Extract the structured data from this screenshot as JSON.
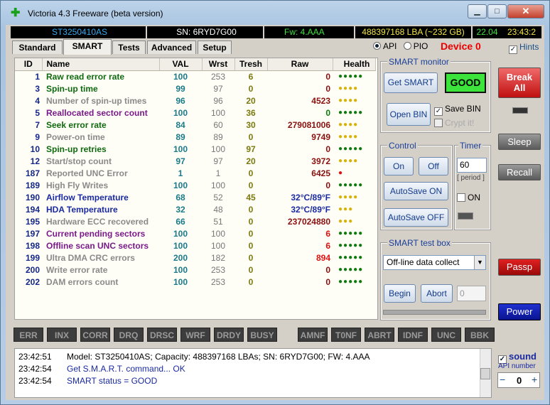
{
  "window": {
    "title": "Victoria 4.3 Freeware (beta version)",
    "min": "▁",
    "max": "□",
    "close": "✕",
    "app_icon": "green-plus-icon"
  },
  "info_bar": {
    "model": "ST3250410AS",
    "serial": "SN: 6RYD7G00",
    "firmware": "Fw: 4.AAA",
    "lba": "488397168 LBA (~232 GB)",
    "date": "22.04",
    "time": "23:43:2"
  },
  "tabs": [
    {
      "label": "Standard"
    },
    {
      "label": "SMART"
    },
    {
      "label": "Tests"
    },
    {
      "label": "Advanced"
    },
    {
      "label": "Setup"
    }
  ],
  "mode": {
    "api": "API",
    "pio": "PIO",
    "device": "Device 0",
    "hints": "Hints",
    "hints_check": "✓"
  },
  "table": {
    "headers": {
      "id": "ID",
      "name": "Name",
      "val": "VAL",
      "wrst": "Wrst",
      "tresh": "Tresh",
      "raw": "Raw",
      "health": "Health"
    },
    "rows": [
      {
        "id": "1",
        "name": "Raw read error rate",
        "val": "100",
        "wrst": "253",
        "tresh": "6",
        "raw": "0",
        "health": "●●●●●",
        "name_color": "#0f6a0f",
        "raw_color": "#8a1010",
        "health_color": "#0f7a0f"
      },
      {
        "id": "3",
        "name": "Spin-up time",
        "val": "99",
        "wrst": "97",
        "tresh": "0",
        "raw": "0",
        "health": "●●●●",
        "name_color": "#0f6a0f",
        "raw_color": "#8a1010",
        "health_color": "#d7b20a"
      },
      {
        "id": "4",
        "name": "Number of spin-up times",
        "val": "96",
        "wrst": "96",
        "tresh": "20",
        "raw": "4523",
        "health": "●●●●",
        "name_color": "#8a8a8a",
        "raw_color": "#8a1010",
        "health_color": "#d7b20a"
      },
      {
        "id": "5",
        "name": "Reallocated sector count",
        "val": "100",
        "wrst": "100",
        "tresh": "36",
        "raw": "0",
        "health": "●●●●●",
        "name_color": "#7a1a8a",
        "raw_color": "#0f7a0f",
        "health_color": "#0f7a0f"
      },
      {
        "id": "7",
        "name": "Seek error rate",
        "val": "84",
        "wrst": "60",
        "tresh": "30",
        "raw": "279081006",
        "health": "●●●●",
        "name_color": "#0f6a0f",
        "raw_color": "#8a1010",
        "health_color": "#d7b20a"
      },
      {
        "id": "9",
        "name": "Power-on time",
        "val": "89",
        "wrst": "89",
        "tresh": "0",
        "raw": "9749",
        "health": "●●●●",
        "name_color": "#8a8a8a",
        "raw_color": "#8a1010",
        "health_color": "#d7b20a"
      },
      {
        "id": "10",
        "name": "Spin-up retries",
        "val": "100",
        "wrst": "100",
        "tresh": "97",
        "raw": "0",
        "health": "●●●●●",
        "name_color": "#0f6a0f",
        "raw_color": "#8a1010",
        "health_color": "#0f7a0f"
      },
      {
        "id": "12",
        "name": "Start/stop count",
        "val": "97",
        "wrst": "97",
        "tresh": "20",
        "raw": "3972",
        "health": "●●●●",
        "name_color": "#8a8a8a",
        "raw_color": "#8a1010",
        "health_color": "#d7b20a"
      },
      {
        "id": "187",
        "name": "Reported UNC Error",
        "val": "1",
        "wrst": "1",
        "tresh": "0",
        "raw": "6425",
        "health": "●",
        "name_color": "#8a8a8a",
        "raw_color": "#8a1010",
        "health_color": "#e01010"
      },
      {
        "id": "189",
        "name": "High Fly Writes",
        "val": "100",
        "wrst": "100",
        "tresh": "0",
        "raw": "0",
        "health": "●●●●●",
        "name_color": "#8a8a8a",
        "raw_color": "#8a1010",
        "health_color": "#0f7a0f"
      },
      {
        "id": "190",
        "name": "Airflow Temperature",
        "val": "68",
        "wrst": "52",
        "tresh": "45",
        "raw": "32°C/89°F",
        "health": "●●●●",
        "name_color": "#1a2aa0",
        "raw_color": "#1a2aa0",
        "health_color": "#d7b20a"
      },
      {
        "id": "194",
        "name": "HDA Temperature",
        "val": "32",
        "wrst": "48",
        "tresh": "0",
        "raw": "32°C/89°F",
        "health": "●●●",
        "name_color": "#1a2aa0",
        "raw_color": "#1a2aa0",
        "health_color": "#d7b20a"
      },
      {
        "id": "195",
        "name": "Hardware ECC recovered",
        "val": "66",
        "wrst": "51",
        "tresh": "0",
        "raw": "237024880",
        "health": "●●●",
        "name_color": "#8a8a8a",
        "raw_color": "#8a1010",
        "health_color": "#d7b20a"
      },
      {
        "id": "197",
        "name": "Current pending sectors",
        "val": "100",
        "wrst": "100",
        "tresh": "0",
        "raw": "6",
        "health": "●●●●●",
        "name_color": "#7a1a8a",
        "raw_color": "#e01010",
        "health_color": "#0f7a0f"
      },
      {
        "id": "198",
        "name": "Offline scan UNC sectors",
        "val": "100",
        "wrst": "100",
        "tresh": "0",
        "raw": "6",
        "health": "●●●●●",
        "name_color": "#7a1a8a",
        "raw_color": "#e01010",
        "health_color": "#0f7a0f"
      },
      {
        "id": "199",
        "name": "Ultra DMA CRC errors",
        "val": "200",
        "wrst": "182",
        "tresh": "0",
        "raw": "894",
        "health": "●●●●●",
        "name_color": "#8a8a8a",
        "raw_color": "#e01010",
        "health_color": "#0f7a0f"
      },
      {
        "id": "200",
        "name": "Write error rate",
        "val": "100",
        "wrst": "253",
        "tresh": "0",
        "raw": "0",
        "health": "●●●●●",
        "name_color": "#8a8a8a",
        "raw_color": "#8a1010",
        "health_color": "#0f7a0f"
      },
      {
        "id": "202",
        "name": "DAM errors count",
        "val": "100",
        "wrst": "253",
        "tresh": "0",
        "raw": "0",
        "health": "●●●●●",
        "name_color": "#8a8a8a",
        "raw_color": "#8a1010",
        "health_color": "#0f7a0f"
      }
    ]
  },
  "smart_monitor": {
    "title": "SMART monitor",
    "get_smart": "Get SMART",
    "status": "GOOD",
    "open_bin": "Open BIN",
    "save_bin": "Save BIN",
    "save_bin_check": "✓",
    "crypt": "Crypt it!"
  },
  "control": {
    "title": "Control",
    "on": "On",
    "off": "Off",
    "autosave_on": "AutoSave ON",
    "autosave_off": "AutoSave OFF"
  },
  "timer": {
    "title": "Timer",
    "value": "60",
    "period": "[ period ]",
    "on": "ON"
  },
  "test_box": {
    "title": "SMART test box",
    "selected": "Off-line data collect",
    "begin": "Begin",
    "abort": "Abort",
    "value": "0",
    "arrow": "▼"
  },
  "side_buttons": {
    "break_all": "Break All",
    "sleep": "Sleep",
    "recall": "Recall",
    "passp": "Passp",
    "power": "Power"
  },
  "flags": [
    "ERR",
    "INX",
    "CORR",
    "DRQ",
    "DRSC",
    "WRF",
    "DRDY",
    "BUSY",
    "AMNF",
    "T0NF",
    "ABRT",
    "IDNF",
    "UNC",
    "BBK"
  ],
  "log": [
    {
      "time": "23:42:51",
      "text": "Model: ST3250410AS; Capacity: 488397168 LBAs; SN: 6RYD7G00; FW: 4.AAA",
      "color": "#000000"
    },
    {
      "time": "23:42:54",
      "text": "Get S.M.A.R.T. command... OK",
      "color": "#1a2aa0"
    },
    {
      "time": "23:42:54",
      "text": "SMART status = GOOD",
      "color": "#1a2aa0"
    }
  ],
  "sound": {
    "label": "sound",
    "check": "✓",
    "api_number": "API number",
    "minus": "−",
    "value": "0",
    "plus": "+"
  }
}
